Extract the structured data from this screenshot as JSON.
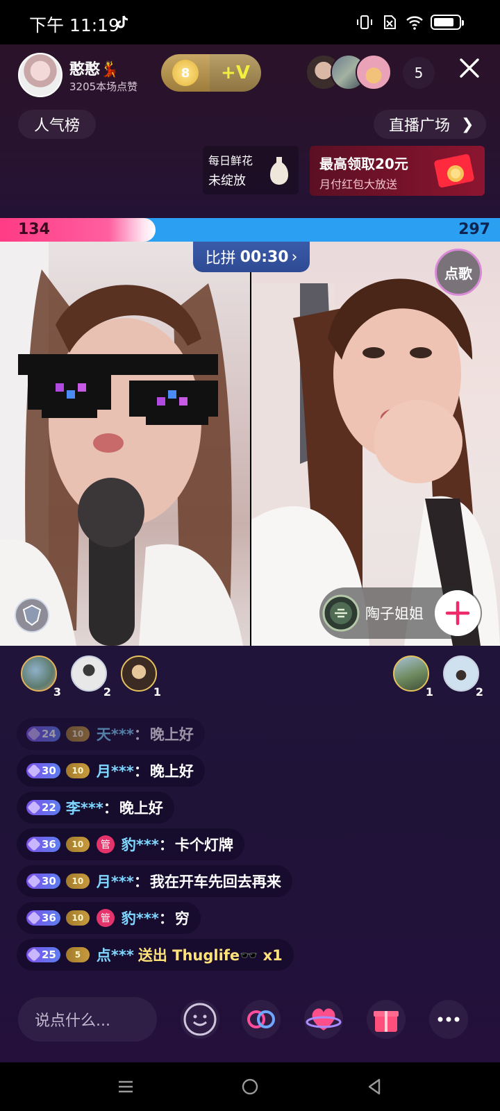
{
  "status": {
    "time": "下午 11:19"
  },
  "host": {
    "name": "憨憨💃",
    "likes": "3205本场点赞",
    "fan_level": "8",
    "vip_label": "+V"
  },
  "viewers": {
    "count": "5"
  },
  "nav": {
    "popularity_label": "人气榜",
    "plaza_label": "直播广场"
  },
  "promo": {
    "flower_line1": "每日鲜花",
    "flower_line2": "未绽放",
    "redpack_line1": "最高领取20元",
    "redpack_line2": "月付红包大放送"
  },
  "pk": {
    "left_score": "134",
    "right_score": "297",
    "left_fraction": 0.311,
    "label": "比拼",
    "timer": "00:30"
  },
  "stage": {
    "song_label": "点歌",
    "opponent_name": "陶子姐姐"
  },
  "contributors_left": [
    {
      "rank": "3"
    },
    {
      "rank": "2"
    },
    {
      "rank": "1"
    }
  ],
  "contributors_right": [
    {
      "rank": "1"
    },
    {
      "rank": "2"
    }
  ],
  "chat": [
    {
      "level": "24",
      "fan": "10",
      "user": "天***",
      "sep": "：",
      "text": "晚上好"
    },
    {
      "level": "30",
      "fan": "10",
      "user": "月***",
      "sep": "：",
      "text": "晚上好"
    },
    {
      "level": "22",
      "user": "李***",
      "sep": "：",
      "text": "晚上好"
    },
    {
      "level": "36",
      "fan": "10",
      "mgr": "管",
      "user": "豹***",
      "sep": "：",
      "text": "卡个灯牌"
    },
    {
      "level": "30",
      "fan": "10",
      "user": "月***",
      "sep": "：",
      "text": "我在开车先回去再来"
    },
    {
      "level": "36",
      "fan": "10",
      "mgr": "管",
      "user": "豹***",
      "sep": "：",
      "text": "穷"
    },
    {
      "level": "25",
      "fan": "5",
      "user": "点***",
      "text": "送出 Thuglife🕶️ x1"
    }
  ],
  "input": {
    "placeholder": "说点什么..."
  },
  "colors": {
    "pk_pink": "#ff3b85",
    "pk_blue": "#2ba0f2",
    "username": "#7fd7ff",
    "gift_text": "#ffe27a"
  }
}
